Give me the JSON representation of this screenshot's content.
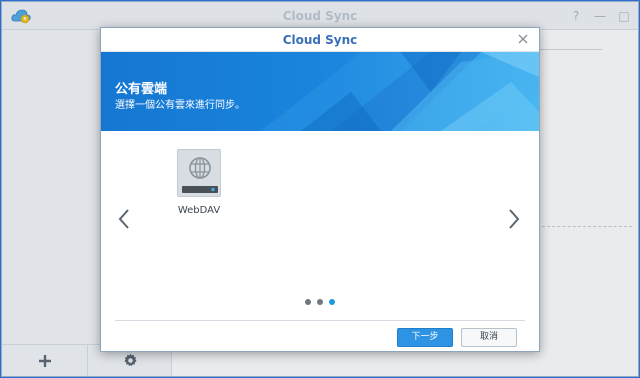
{
  "app": {
    "title": "Cloud Sync",
    "window_controls": [
      "?",
      "—",
      "□"
    ],
    "bottom_bar": {
      "add_icon": "plus-icon",
      "settings_icon": "gear-icon"
    }
  },
  "dialog": {
    "title": "Cloud Sync",
    "close_icon": "close-icon",
    "banner": {
      "title": "公有雲端",
      "subtitle": "選擇一個公有雲來進行同步。"
    },
    "providers": [
      {
        "name": "WebDAV",
        "icon": "globe-server-icon"
      }
    ],
    "pager": {
      "pages": 3,
      "active_page": 3
    },
    "buttons": {
      "next": "下一步",
      "cancel": "取消"
    }
  },
  "colors": {
    "accent": "#1b9ae0",
    "banner": "#1a7fd8",
    "title_text": "#3a6fb8"
  }
}
